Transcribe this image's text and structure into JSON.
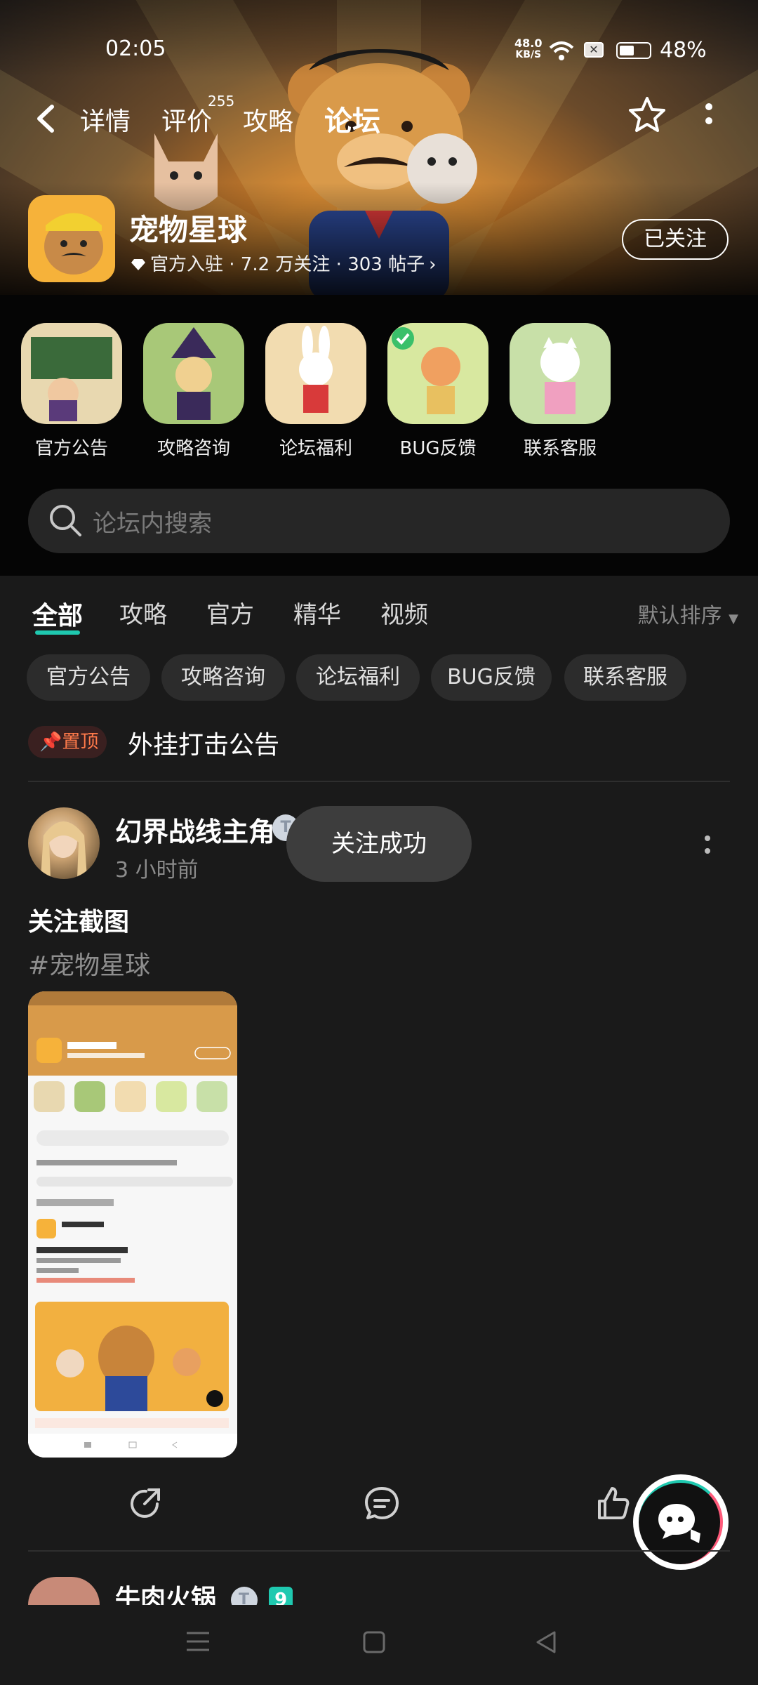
{
  "status_bar": {
    "time": "02:05",
    "net_speed_value": "48.0",
    "net_speed_unit": "KB/S",
    "battery_percent": "48%",
    "battery_level": 0.48,
    "icons": [
      "wifi-icon",
      "notification-icon",
      "battery-icon"
    ]
  },
  "header": {
    "tabs": [
      {
        "label": "详情"
      },
      {
        "label": "评价",
        "count": "255"
      },
      {
        "label": "攻略"
      },
      {
        "label": "论坛",
        "active": true
      }
    ]
  },
  "game": {
    "name": "宠物星球",
    "meta": "官方入驻 · 7.2 万关注 · 303 帖子",
    "follow_label": "已关注"
  },
  "categories": [
    {
      "label": "官方公告"
    },
    {
      "label": "攻略咨询"
    },
    {
      "label": "论坛福利"
    },
    {
      "label": "BUG反馈"
    },
    {
      "label": "联系客服"
    }
  ],
  "search": {
    "placeholder": "论坛内搜索"
  },
  "filter_tabs": [
    {
      "label": "全部",
      "active": true
    },
    {
      "label": "攻略"
    },
    {
      "label": "官方"
    },
    {
      "label": "精华"
    },
    {
      "label": "视频"
    }
  ],
  "sort_label": "默认排序",
  "chips": [
    "官方公告",
    "攻略咨询",
    "论坛福利",
    "BUG反馈",
    "联系客服"
  ],
  "pinned": {
    "badge": "置顶",
    "title": "外挂打击公告"
  },
  "post": {
    "author": "幻界战线主角",
    "badge": "T",
    "time": "3 小时前",
    "title": "关注截图",
    "tag": "#宠物星球"
  },
  "toast": "关注成功",
  "next_post": {
    "author": "牛肉火锅",
    "badge": "T",
    "level": "9"
  },
  "colors": {
    "accent": "#1fc9b0",
    "pin": "#ff7a4a",
    "background": "#1a1a1a"
  }
}
